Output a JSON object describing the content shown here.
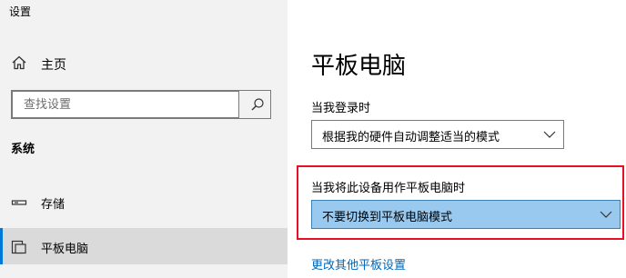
{
  "window": {
    "title": "设置"
  },
  "sidebar": {
    "home": {
      "label": "主页",
      "icon": "home-icon"
    },
    "search": {
      "placeholder": "查找设置",
      "icon": "search-icon"
    },
    "section_heading": "系统",
    "items": [
      {
        "label": "存储",
        "icon": "storage-icon",
        "selected": false
      },
      {
        "label": "平板电脑",
        "icon": "tablet-mode-icon",
        "selected": true
      }
    ]
  },
  "content": {
    "page_title": "平板电脑",
    "signin_setting": {
      "label": "当我登录时",
      "selected_value": "根据我的硬件自动调整适当的模式"
    },
    "tablet_use_setting": {
      "label": "当我将此设备用作平板电脑时",
      "selected_value": "不要切换到平板电脑模式"
    },
    "more_link": "更改其他平板设置"
  },
  "colors": {
    "sidebar_bg": "#f2f2f2",
    "selected_item_bg": "#dadada",
    "accent": "#0078d7",
    "link": "#0067b8",
    "highlight_border": "#e81123",
    "dropdown_focused_bg": "#99c9ee"
  }
}
